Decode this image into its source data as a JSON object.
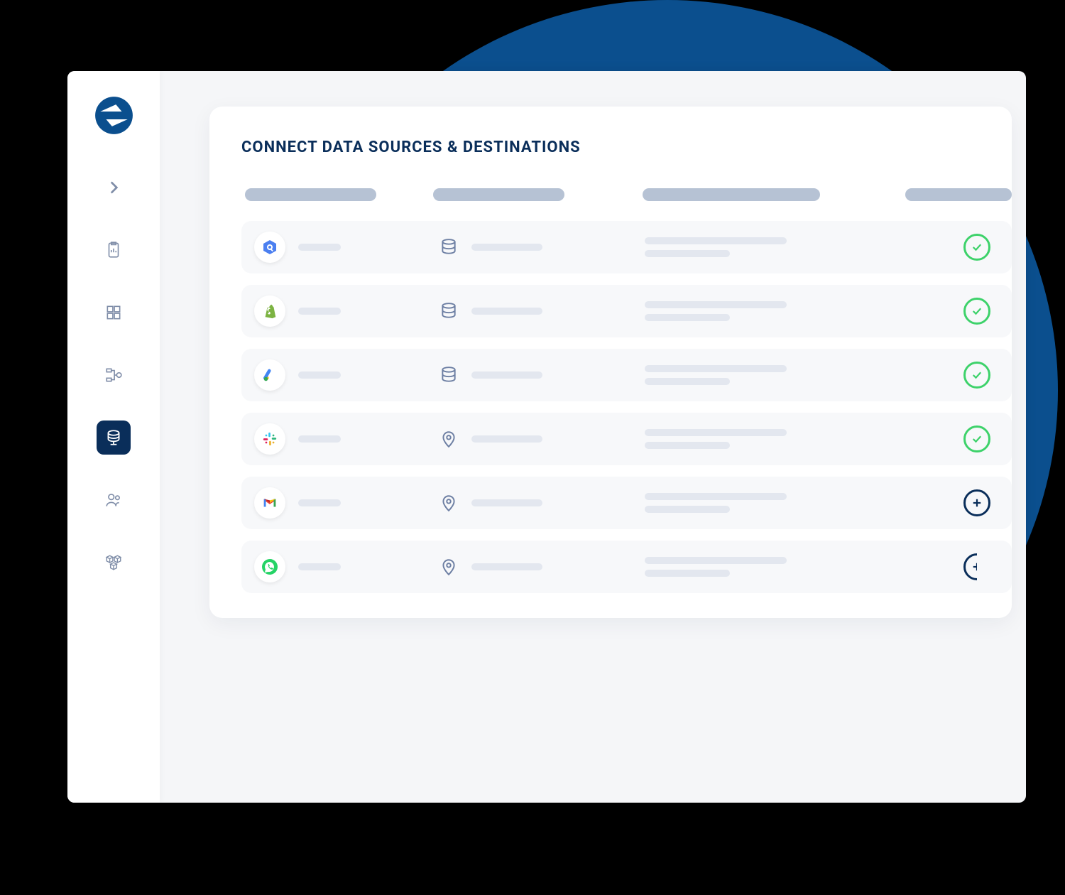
{
  "panel": {
    "title": "CONNECT DATA SOURCES & DESTINATIONS"
  },
  "sidebar": {
    "items": [
      {
        "icon": "expand",
        "active": false
      },
      {
        "icon": "clipboard",
        "active": false
      },
      {
        "icon": "grid",
        "active": false
      },
      {
        "icon": "flow",
        "active": false
      },
      {
        "icon": "database",
        "active": true
      },
      {
        "icon": "users",
        "active": false
      },
      {
        "icon": "cubes",
        "active": false
      }
    ]
  },
  "rows": [
    {
      "source": "bigquery",
      "dest": "database",
      "status": "ok"
    },
    {
      "source": "shopify",
      "dest": "database",
      "status": "ok"
    },
    {
      "source": "googleads",
      "dest": "database",
      "status": "ok"
    },
    {
      "source": "slack",
      "dest": "location",
      "status": "ok"
    },
    {
      "source": "gmail",
      "dest": "location",
      "status": "add"
    },
    {
      "source": "whatsapp",
      "dest": "location",
      "status": "add-partial"
    }
  ]
}
